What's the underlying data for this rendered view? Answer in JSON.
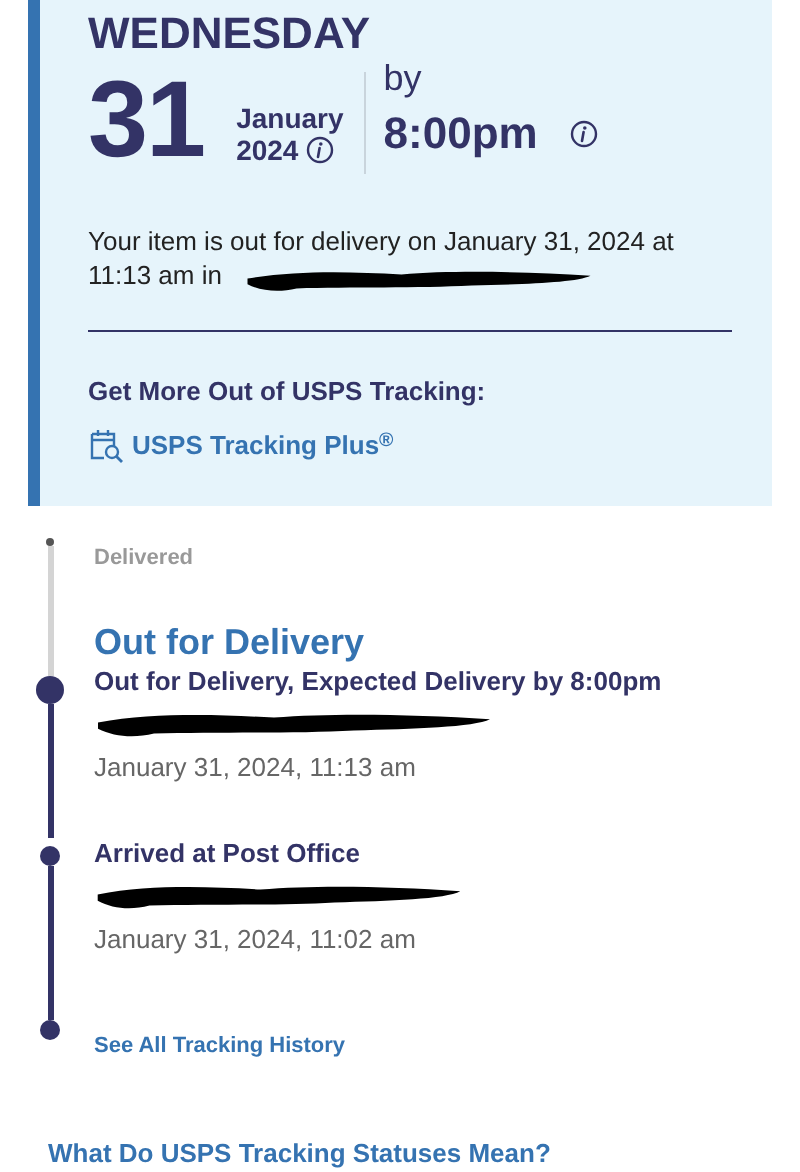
{
  "delivery": {
    "weekday": "WEDNESDAY",
    "day": "31",
    "month": "January",
    "year": "2024",
    "by_label": "by",
    "time": "8:00pm"
  },
  "message": {
    "text": "Your item is out for delivery on January 31, 2024 at 11:13 am in",
    "redacted": true
  },
  "promo": {
    "heading": "Get More Out of USPS Tracking:",
    "link": "USPS Tracking Plus$^{®}$"
  },
  "steps": [
    {
      "kind": "upcoming",
      "status": "Delivered"
    },
    {
      "kind": "current",
      "heading": "Out for Delivery",
      "status": "Out for Delivery, Expected Delivery by 8:00pm",
      "redacted": true,
      "time": "January 31, 2024, 11:13 am"
    },
    {
      "kind": "past",
      "status": "Arrived at Post Office",
      "redacted": true,
      "time": "January 31, 2024, 11:02 am"
    },
    {
      "kind": "link",
      "status": "See All Tracking History"
    }
  ],
  "statuses_link": "What Do USPS Tracking Statuses Mean?"
}
